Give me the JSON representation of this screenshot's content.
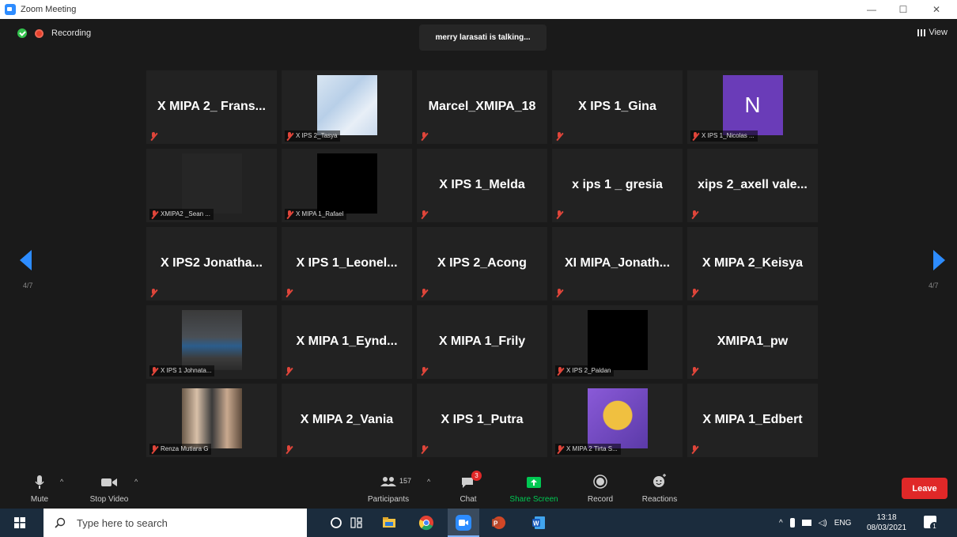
{
  "window": {
    "title": "Zoom Meeting"
  },
  "status": {
    "recording": "Recording",
    "talking": "merry larasati is talking...",
    "view": "View"
  },
  "nav": {
    "page": "4/7"
  },
  "tiles": [
    {
      "big": "X MIPA 2_ Frans...",
      "label": ""
    },
    {
      "big": "",
      "label": "X IPS 2_Tasya"
    },
    {
      "big": "Marcel_XMIPA_18",
      "label": ""
    },
    {
      "big": "X IPS 1_Gina",
      "label": ""
    },
    {
      "big": "",
      "label": "X IPS 1_Nicolas ...",
      "avatar_letter": "N"
    },
    {
      "big": "",
      "label": "XMIPA2 _Sean ..."
    },
    {
      "big": "",
      "label": "X MIPA 1_Rafael"
    },
    {
      "big": "X IPS 1_Melda",
      "label": ""
    },
    {
      "big": "x ips 1 _ gresia",
      "label": ""
    },
    {
      "big": "xips 2_axell vale...",
      "label": ""
    },
    {
      "big": "X IPS2 Jonatha...",
      "label": ""
    },
    {
      "big": "X IPS 1_Leonel...",
      "label": ""
    },
    {
      "big": "X IPS 2_Acong",
      "label": ""
    },
    {
      "big": "XI MIPA_Jonath...",
      "label": ""
    },
    {
      "big": "X MIPA 2_Keisya",
      "label": ""
    },
    {
      "big": "",
      "label": "X IPS 1 Johnata..."
    },
    {
      "big": "X MIPA 1_Eynd...",
      "label": ""
    },
    {
      "big": "X MIPA 1_Frily",
      "label": ""
    },
    {
      "big": "",
      "label": "X IPS 2_Paldan"
    },
    {
      "big": "XMIPA1_pw",
      "label": ""
    },
    {
      "big": "",
      "label": "Renza Mutiara G"
    },
    {
      "big": "X MIPA 2_Vania",
      "label": ""
    },
    {
      "big": "X IPS 1_Putra",
      "label": ""
    },
    {
      "big": "",
      "label": "X MIPA 2 Tirta S..."
    },
    {
      "big": "X MIPA 1_Edbert",
      "label": ""
    }
  ],
  "toolbar": {
    "mute": "Mute",
    "stop_video": "Stop Video",
    "participants": "Participants",
    "participants_count": "157",
    "chat": "Chat",
    "chat_badge": "3",
    "share": "Share Screen",
    "record": "Record",
    "reactions": "Reactions",
    "leave": "Leave"
  },
  "taskbar": {
    "search_placeholder": "Type here to search",
    "lang": "ENG",
    "time": "13:18",
    "date": "08/03/2021",
    "notif_count": "1"
  },
  "colors": {
    "accent": "#2d8cff",
    "leave": "#e02828",
    "share": "#00c853",
    "muted": "#e0453a"
  }
}
